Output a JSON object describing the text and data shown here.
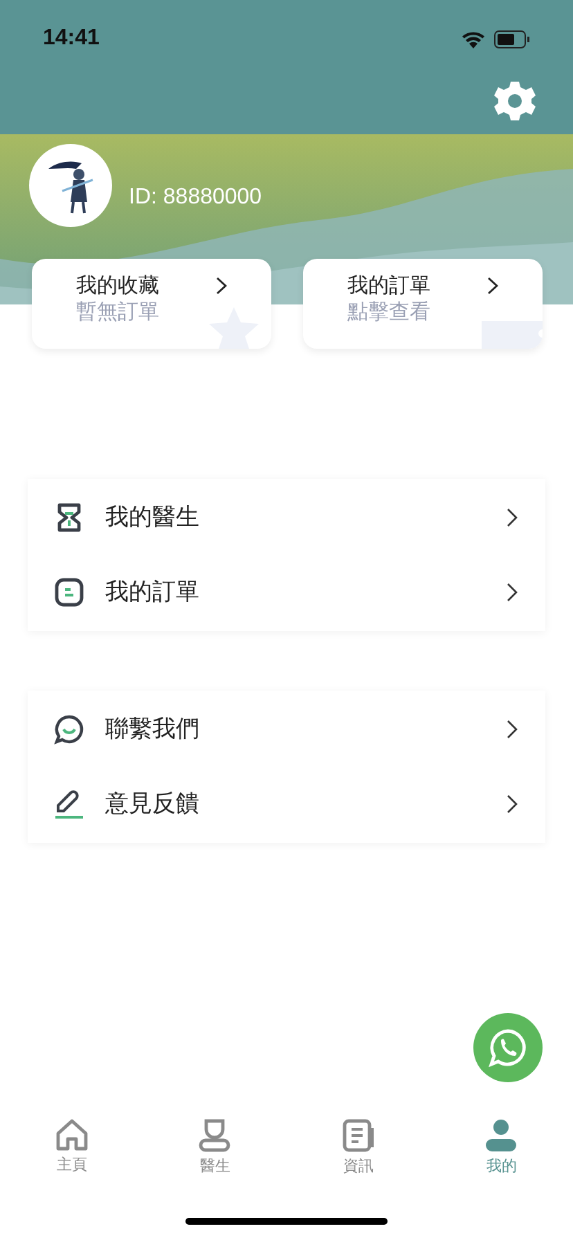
{
  "status_bar": {
    "time": "14:41"
  },
  "profile": {
    "id_text": "ID: 88880000"
  },
  "quick_cards": [
    {
      "title": "我的收藏",
      "subtitle": "暫無訂單",
      "kind": "star"
    },
    {
      "title": "我的訂單",
      "subtitle": "點擊查看",
      "kind": "ticket"
    }
  ],
  "menu_groups": [
    [
      {
        "label": "我的醫生",
        "kind": "doctor"
      },
      {
        "label": "我的訂單",
        "kind": "order"
      }
    ],
    [
      {
        "label": "聯繫我們",
        "kind": "chat"
      },
      {
        "label": "意見反饋",
        "kind": "pen"
      }
    ]
  ],
  "tab_bar": [
    {
      "label": "主頁",
      "kind": "home",
      "selected": false
    },
    {
      "label": "醫生",
      "kind": "doctor",
      "selected": false
    },
    {
      "label": "資訊",
      "kind": "news",
      "selected": false
    },
    {
      "label": "我的",
      "kind": "me",
      "selected": true
    }
  ]
}
